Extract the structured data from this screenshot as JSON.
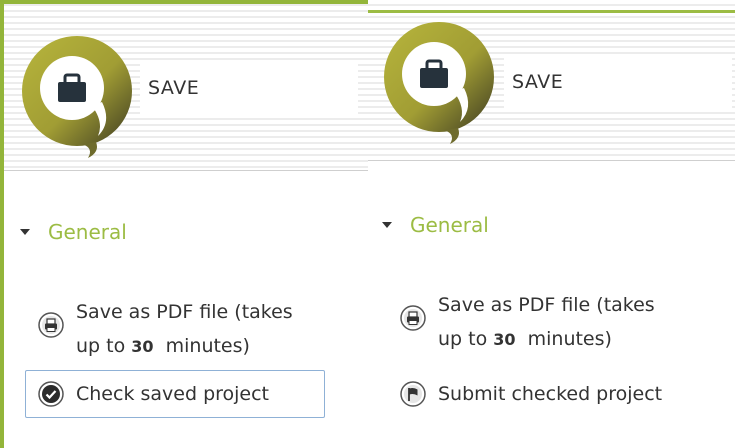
{
  "colors": {
    "accent": "#9cbc44",
    "logo_olive": "#a8a532",
    "frame": "#93b53a",
    "focus_border": "#8fb1d6"
  },
  "left_panel": {
    "header": {
      "icon": "briefcase-icon",
      "title": "SAVE"
    },
    "section": {
      "label": "General"
    },
    "items": [
      {
        "icon": "printer-icon",
        "line1": "Save as PDF file (takes",
        "line2_pre": "up to ",
        "line2_num": "30",
        "line2_post": "  minutes)"
      },
      {
        "icon": "checkmark-circle-icon",
        "label": "Check saved project"
      }
    ]
  },
  "right_panel": {
    "header": {
      "icon": "briefcase-icon",
      "title": "SAVE"
    },
    "section": {
      "label": "General"
    },
    "items": [
      {
        "icon": "printer-icon",
        "line1": "Save as PDF file (takes",
        "line2_pre": "up to ",
        "line2_num": "30",
        "line2_post": "  minutes)"
      },
      {
        "icon": "flag-icon",
        "label": "Submit checked project"
      }
    ]
  }
}
